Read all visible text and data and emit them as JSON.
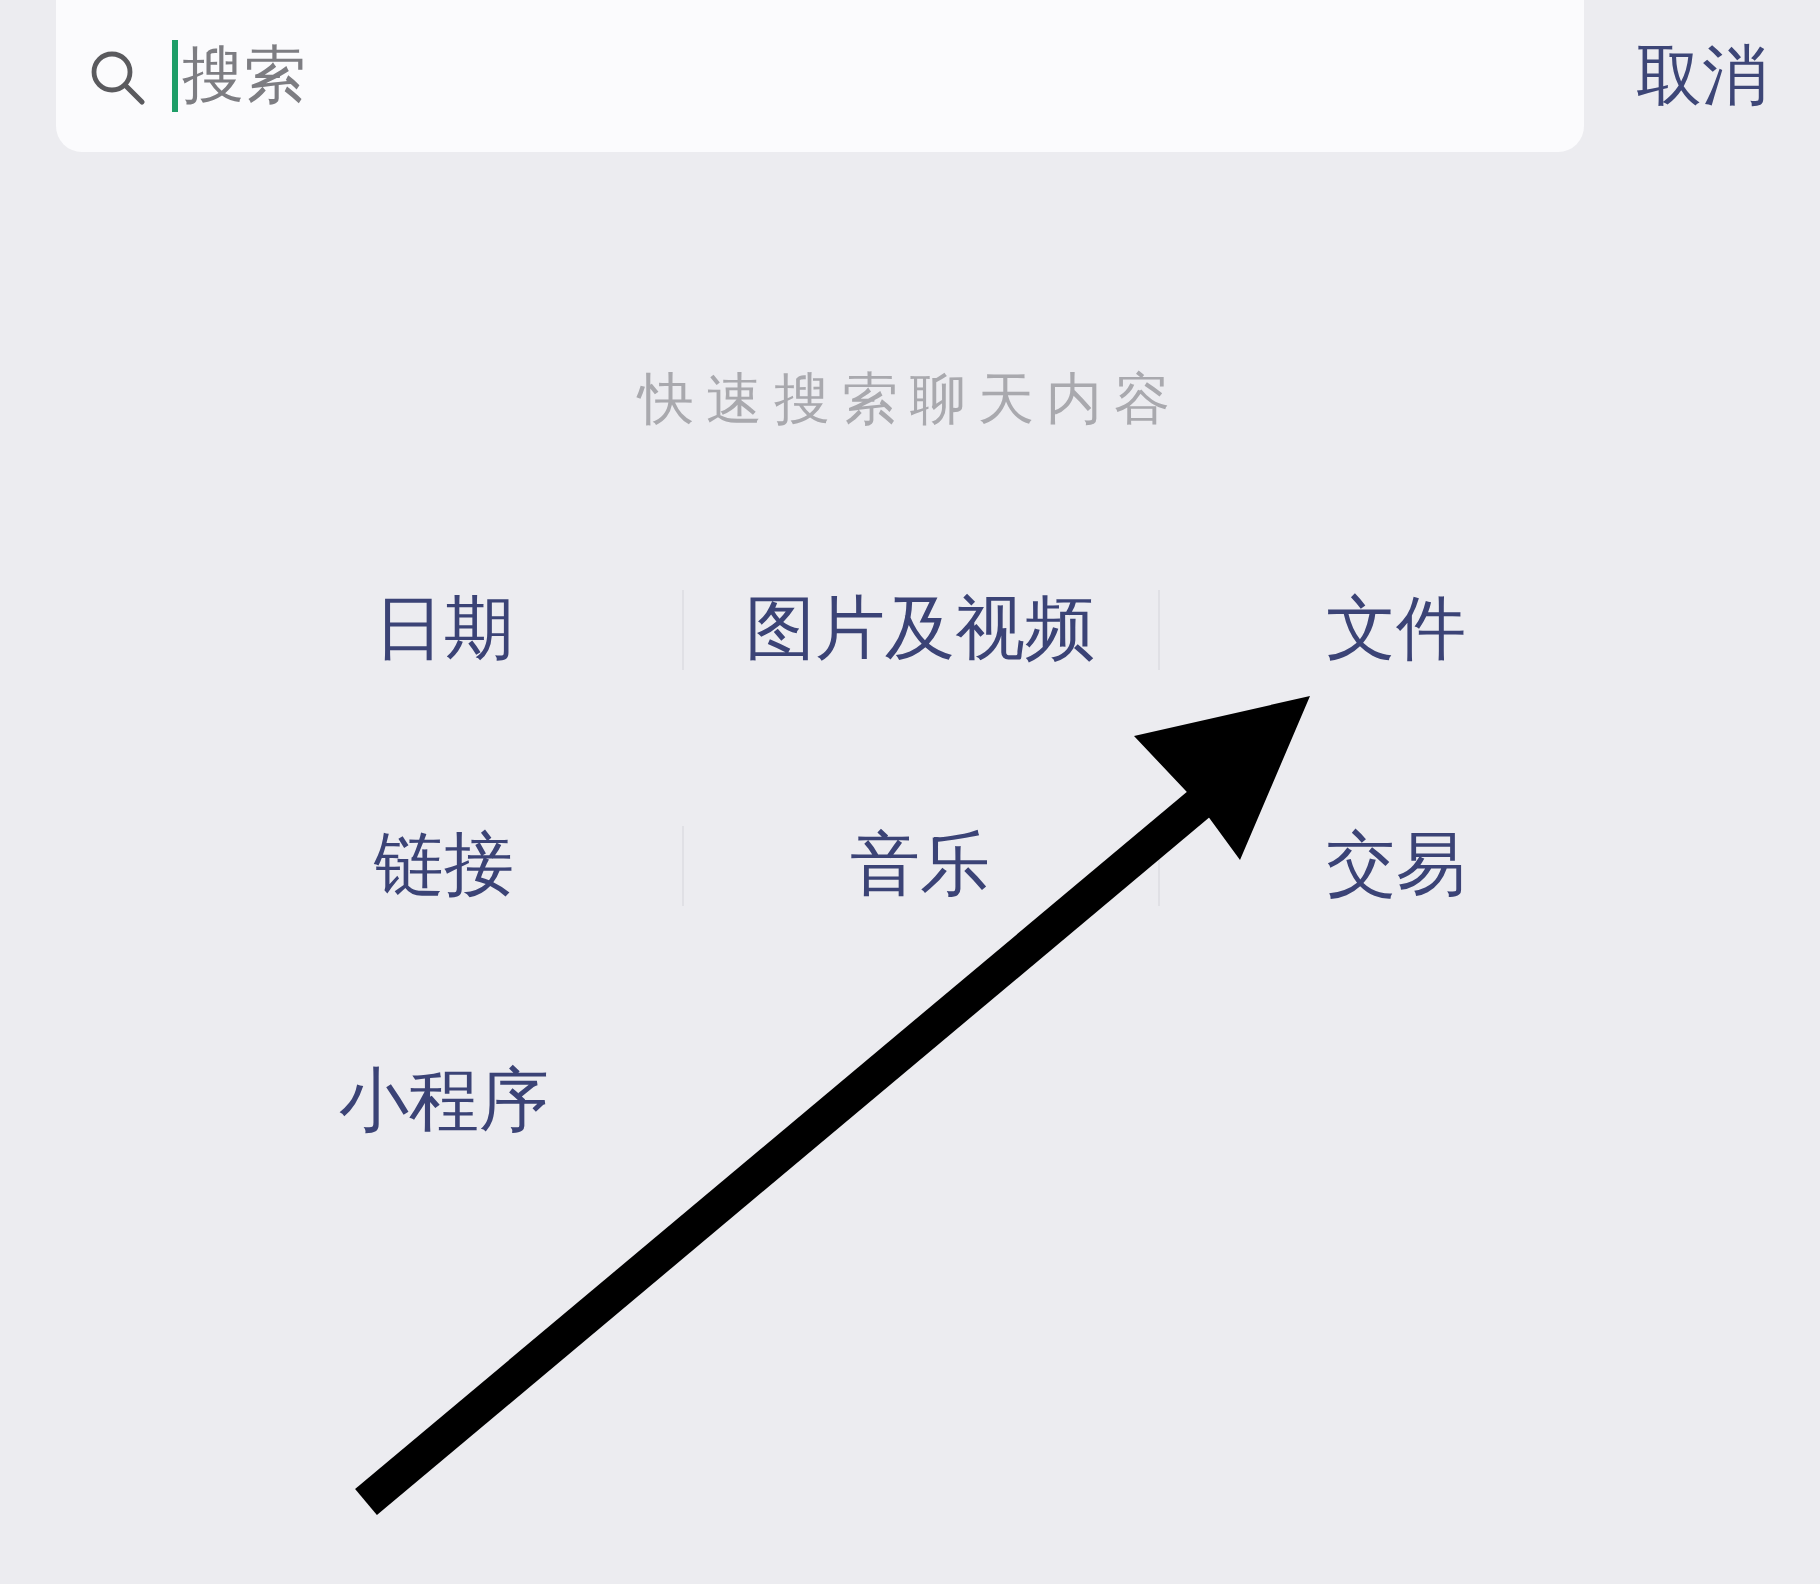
{
  "search": {
    "placeholder": "搜索",
    "focused": true
  },
  "cancel": "取消",
  "hint": "快速搜索聊天内容",
  "categories": [
    {
      "label": "日期"
    },
    {
      "label": "图片及视频"
    },
    {
      "label": "文件"
    },
    {
      "label": "链接"
    },
    {
      "label": "音乐"
    },
    {
      "label": "交易"
    },
    {
      "label": "小程序"
    }
  ]
}
